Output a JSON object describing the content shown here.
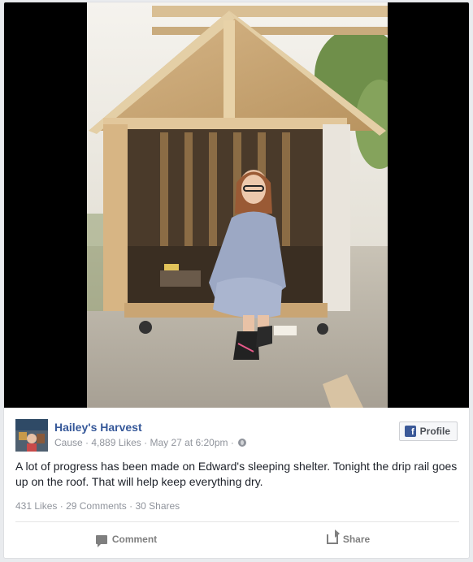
{
  "post": {
    "page_name": "Hailey's Harvest",
    "category": "Cause",
    "page_likes": "4,889 Likes",
    "timestamp": "May 27 at 6:20pm",
    "profile_button": "Profile",
    "text": "A lot of progress has been made on Edward's sleeping shelter. Tonight the drip rail goes up on the roof. That will help keep everything dry.",
    "likes": "431 Likes",
    "comments": "29 Comments",
    "shares": "30 Shares"
  },
  "actions": {
    "comment": "Comment",
    "share": "Share"
  },
  "icons": {
    "profile": "facebook-f-icon",
    "privacy": "globe-icon",
    "comment": "comment-bubble-icon",
    "share": "share-arrow-icon"
  },
  "colors": {
    "page_name": "#365899",
    "meta_text": "#90949c",
    "facebook_blue": "#3b5998"
  }
}
